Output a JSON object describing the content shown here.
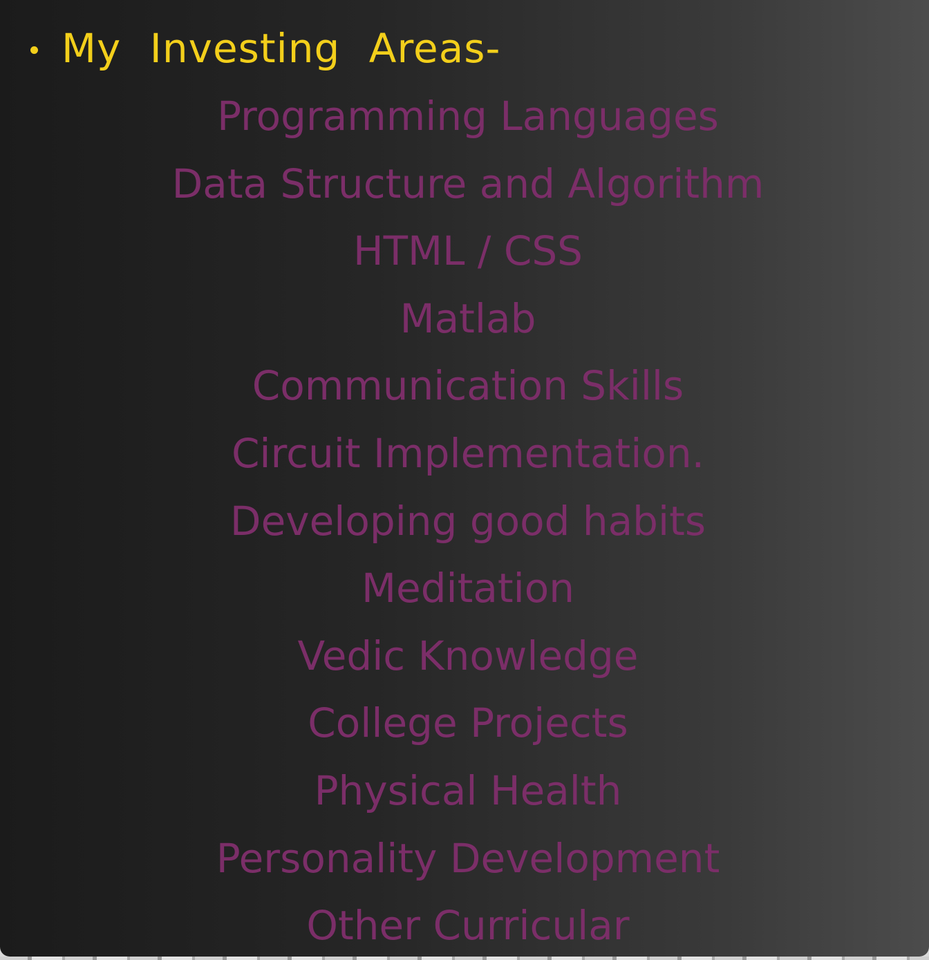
{
  "heading": "My  Investing  Areas-",
  "items": [
    "Programming Languages",
    "Data Structure and Algorithm",
    "HTML / CSS",
    "Matlab",
    "Communication Skills",
    "Circuit Implementation.",
    "Developing good habits",
    "Meditation",
    "Vedic Knowledge",
    "College Projects",
    "Physical Health",
    "Personality Development",
    "Other Curricular"
  ],
  "colors": {
    "heading": "#f3cf1b",
    "items": "#7b2e68",
    "background_dark": "#1b1b1b",
    "background_light": "#4c4c4c"
  }
}
